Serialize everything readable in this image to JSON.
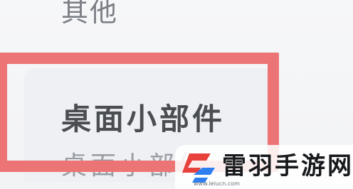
{
  "settings_list": {
    "previous_item_label": "其他",
    "current_item": {
      "title": "桌面小部件",
      "subtitle": "桌面小部件"
    },
    "highlight_color": "#ec7474"
  },
  "watermark": {
    "name": "雷羽手游网",
    "url": "www.leiucn.com",
    "logo_icon": "leiyu-logo-icon",
    "logo_colors": [
      "#e8413c",
      "#2f7ff0"
    ]
  }
}
